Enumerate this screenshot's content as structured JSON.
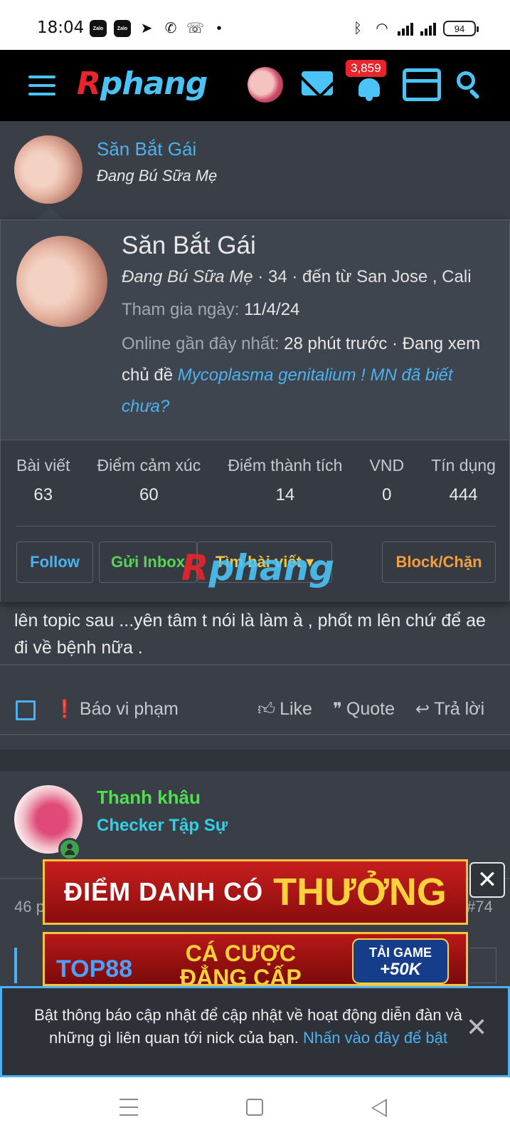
{
  "status_bar": {
    "time": "18:04",
    "app_icons": [
      "zalo-icon",
      "zalo-icon",
      "telegram-icon",
      "viber-icon",
      "call-icon",
      "dot-icon"
    ],
    "zalo_label": "Zalo",
    "battery": "94"
  },
  "header": {
    "logo_first": "R",
    "logo_rest": "phang",
    "notification_count": "3,859"
  },
  "post": {
    "author": "Săn Bắt Gái",
    "author_title": "Đang Bú Sữa Mẹ",
    "body": "lên topic sau ...yên tâm t nói là làm à , phốt m lên chứ để ae đi về bệnh nữa .",
    "actions": {
      "report": "Báo vi phạm",
      "like": "Like",
      "quote": "Quote",
      "reply": "Trả lời"
    }
  },
  "profile_popup": {
    "name": "Săn Bắt Gái",
    "title": "Đang Bú Sữa Mẹ",
    "age_location": " · 34 · đến từ San Jose , Cali",
    "joined_label": "Tham gia ngày:",
    "joined_value": "11/4/24",
    "online_label": "Online gần đây nhất:",
    "online_value": "28 phút trước · Đang xem chủ đề",
    "online_topic": "Mycoplasma genitalium ! MN đã biết chưa?",
    "stats": [
      {
        "label": "Bài viết",
        "value": "63"
      },
      {
        "label": "Điểm cảm xúc",
        "value": "60"
      },
      {
        "label": "Điểm thành tích",
        "value": "14"
      },
      {
        "label": "VND",
        "value": "0"
      },
      {
        "label": "Tín dụng",
        "value": "444"
      }
    ],
    "buttons": {
      "follow": "Follow",
      "inbox": "Gửi Inbox",
      "find_posts": "Tìm bài viết",
      "block": "Block/Chặn"
    }
  },
  "next_post": {
    "author": "Thanh khâu",
    "author_title": "Checker Tập Sự",
    "meta_left": "46 p",
    "post_number": "#74"
  },
  "ads": {
    "banner1_a": "ĐIỂM DANH CÓ",
    "banner1_b": "THƯỞNG",
    "banner2_brand": "TOP88",
    "banner2_slogan_1": "CÁ CƯỢC",
    "banner2_slogan_2": "ĐẲNG CẤP",
    "banner2_cta": "TẢI GAME",
    "banner2_bonus": "+50K"
  },
  "notice": {
    "text": "Bật thông báo cập nhật để cập nhật về hoạt động diễn đàn và những gì liên quan tới nick của bạn. ",
    "link": "Nhấn vào đây để bật"
  }
}
